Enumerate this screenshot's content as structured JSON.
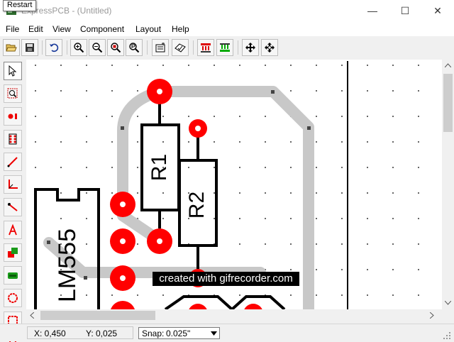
{
  "window": {
    "title": "ExpressPCB - (Untitled)",
    "tooltip": "Restart",
    "controls": {
      "minimize": "—",
      "maximize": "☐",
      "close": "✕"
    }
  },
  "menu": {
    "items": [
      "File",
      "Edit",
      "View",
      "Component",
      "Layout",
      "Help"
    ]
  },
  "toolbar": {
    "buttons": [
      "open",
      "save",
      "undo",
      "zoom-in",
      "zoom-out",
      "zoom-fit",
      "zoom-previous",
      "properties",
      "check",
      "top-layer",
      "bottom-layer",
      "move",
      "align"
    ]
  },
  "tools": {
    "items": [
      "select",
      "zoom-area",
      "pad",
      "component",
      "trace",
      "corner",
      "connect",
      "text",
      "filled-shape",
      "footprint",
      "circle",
      "rectangle",
      "part"
    ]
  },
  "board": {
    "chip_label": "LM555",
    "r1_label": "R1",
    "r2_label": "R2",
    "colors": {
      "pad": "#ff0000",
      "trace": "#c8c8c8",
      "outline": "#000000",
      "grid": "#666666"
    }
  },
  "status": {
    "x": "X: 0,450",
    "y": "Y: 0,025",
    "snap_label": "Snap:",
    "snap_value": "0.025\""
  },
  "watermark": "created with gifrecorder.com"
}
